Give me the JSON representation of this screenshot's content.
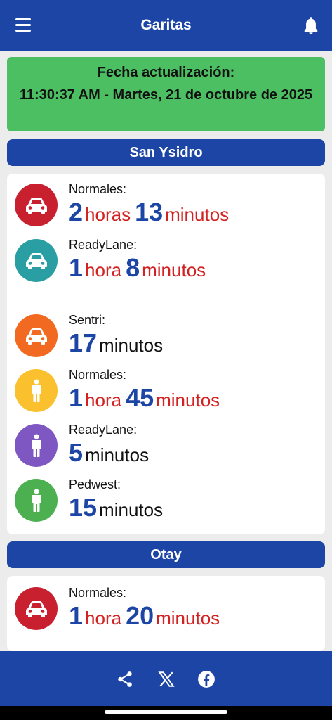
{
  "header": {
    "title": "Garitas",
    "menu_icon": "hamburger-menu-icon",
    "bell_icon": "bell-icon"
  },
  "update": {
    "title": "Fecha actualización:",
    "value": "11:30:37 AM - Martes, 21 de octubre de 2025"
  },
  "sections": [
    {
      "name": "San Ysidro",
      "rows": [
        {
          "label": "Normales:",
          "n1": "2",
          "u1": "horas",
          "n2": "13",
          "u2": "minutos",
          "color": "#c8202f",
          "icon": "car-icon"
        },
        {
          "label": "ReadyLane:",
          "n1": "1",
          "u1": "hora",
          "n2": "8",
          "u2": "minutos",
          "color": "#2a9fa3",
          "icon": "car-icon"
        },
        {
          "label": "Sentri:",
          "n2": "17",
          "u2": "minutos",
          "color": "#f26a21",
          "icon": "car-icon"
        },
        {
          "label": "Normales:",
          "n1": "1",
          "u1": "hora",
          "n2": "45",
          "u2": "minutos",
          "color": "#fbc02d",
          "icon": "pedestrian-icon"
        },
        {
          "label": "ReadyLane:",
          "n2": "5",
          "u2": "minutos",
          "color": "#7e57c2",
          "icon": "pedestrian-icon"
        },
        {
          "label": "Pedwest:",
          "n2": "15",
          "u2": "minutos",
          "color": "#4caf50",
          "icon": "pedestrian-icon"
        }
      ]
    },
    {
      "name": "Otay",
      "rows": [
        {
          "label": "Normales:",
          "n1": "1",
          "u1": "hora",
          "n2": "20",
          "u2": "minutos",
          "color": "#c8202f",
          "icon": "car-icon"
        }
      ]
    }
  ],
  "footer": {
    "icons": [
      "share-icon",
      "x-logo-icon",
      "facebook-icon"
    ]
  }
}
